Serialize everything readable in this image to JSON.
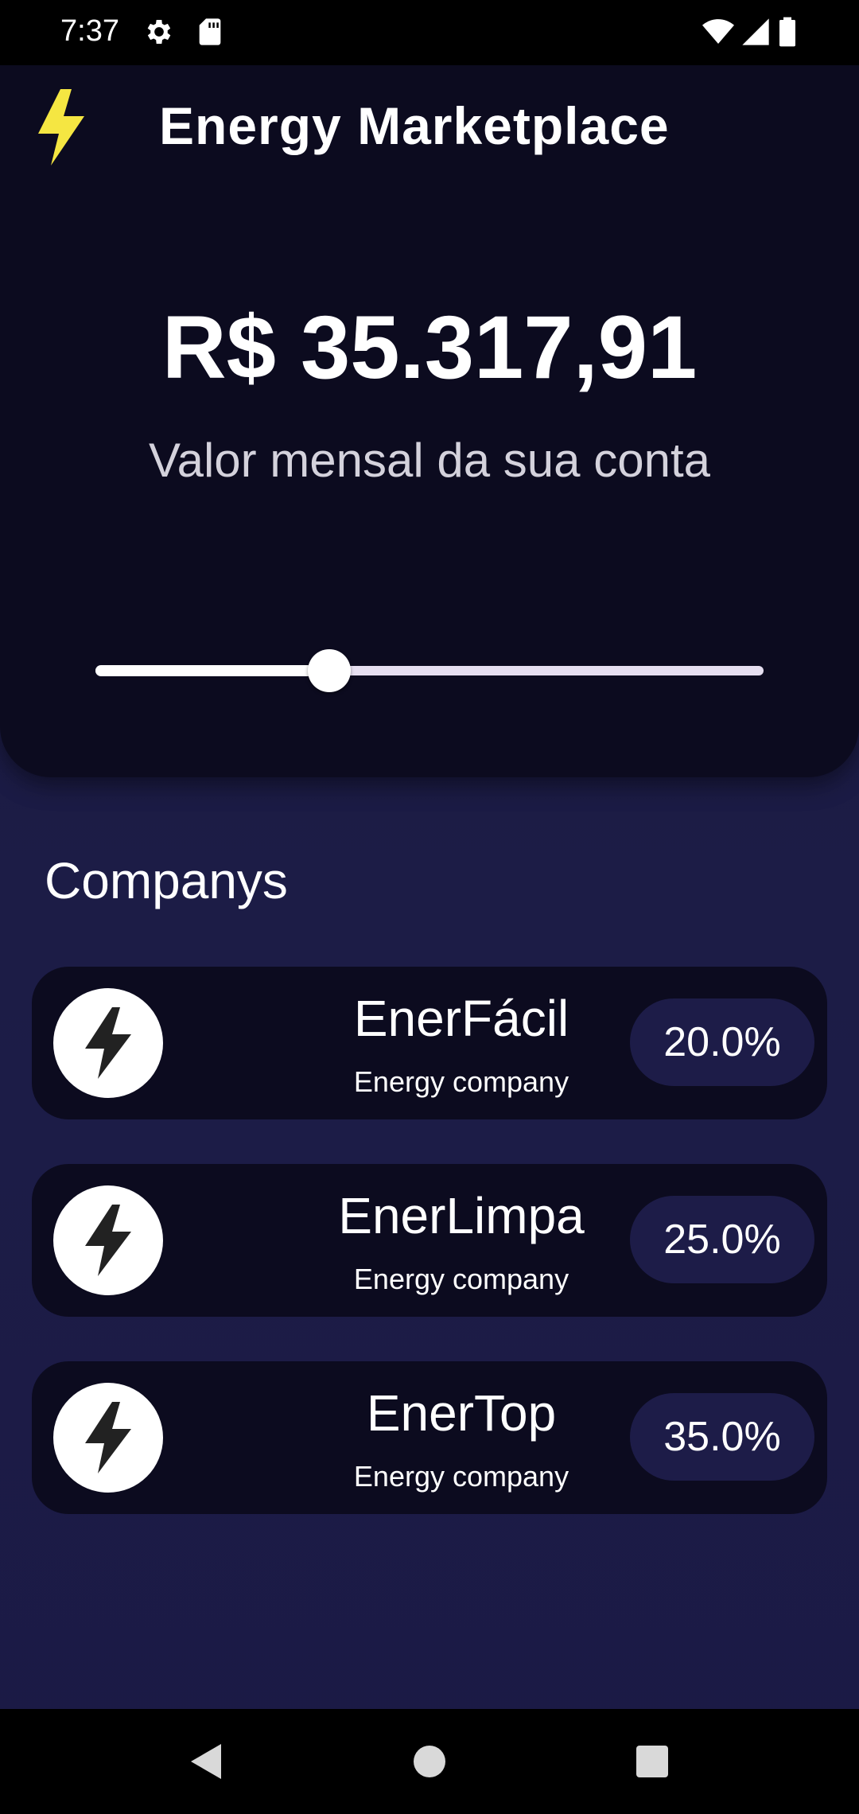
{
  "status_bar": {
    "time": "7:37",
    "icons": [
      "settings-icon",
      "sd-card-icon",
      "wifi-icon",
      "signal-icon",
      "battery-icon"
    ]
  },
  "header": {
    "title": "Energy Marketplace",
    "logo_icon": "lightning-icon",
    "logo_color": "#f5e642",
    "amount": "R$ 35.317,91",
    "caption": "Valor mensal da sua conta",
    "slider_value_fraction": 0.35
  },
  "companies": {
    "title": "Companys",
    "items": [
      {
        "name": "EnerFácil",
        "subtitle": "Energy company",
        "percent": "20.0%",
        "icon": "lightning-icon"
      },
      {
        "name": "EnerLimpa",
        "subtitle": "Energy company",
        "percent": "25.0%",
        "icon": "lightning-icon"
      },
      {
        "name": "EnerTop",
        "subtitle": "Energy company",
        "percent": "35.0%",
        "icon": "lightning-icon"
      }
    ]
  },
  "nav_bar": {
    "icons": [
      "back-icon",
      "home-icon",
      "recents-icon"
    ]
  },
  "colors": {
    "background": "#1b1a45",
    "card": "#0c0b1f",
    "badge": "#1d1c48",
    "accent": "#f5e642"
  }
}
